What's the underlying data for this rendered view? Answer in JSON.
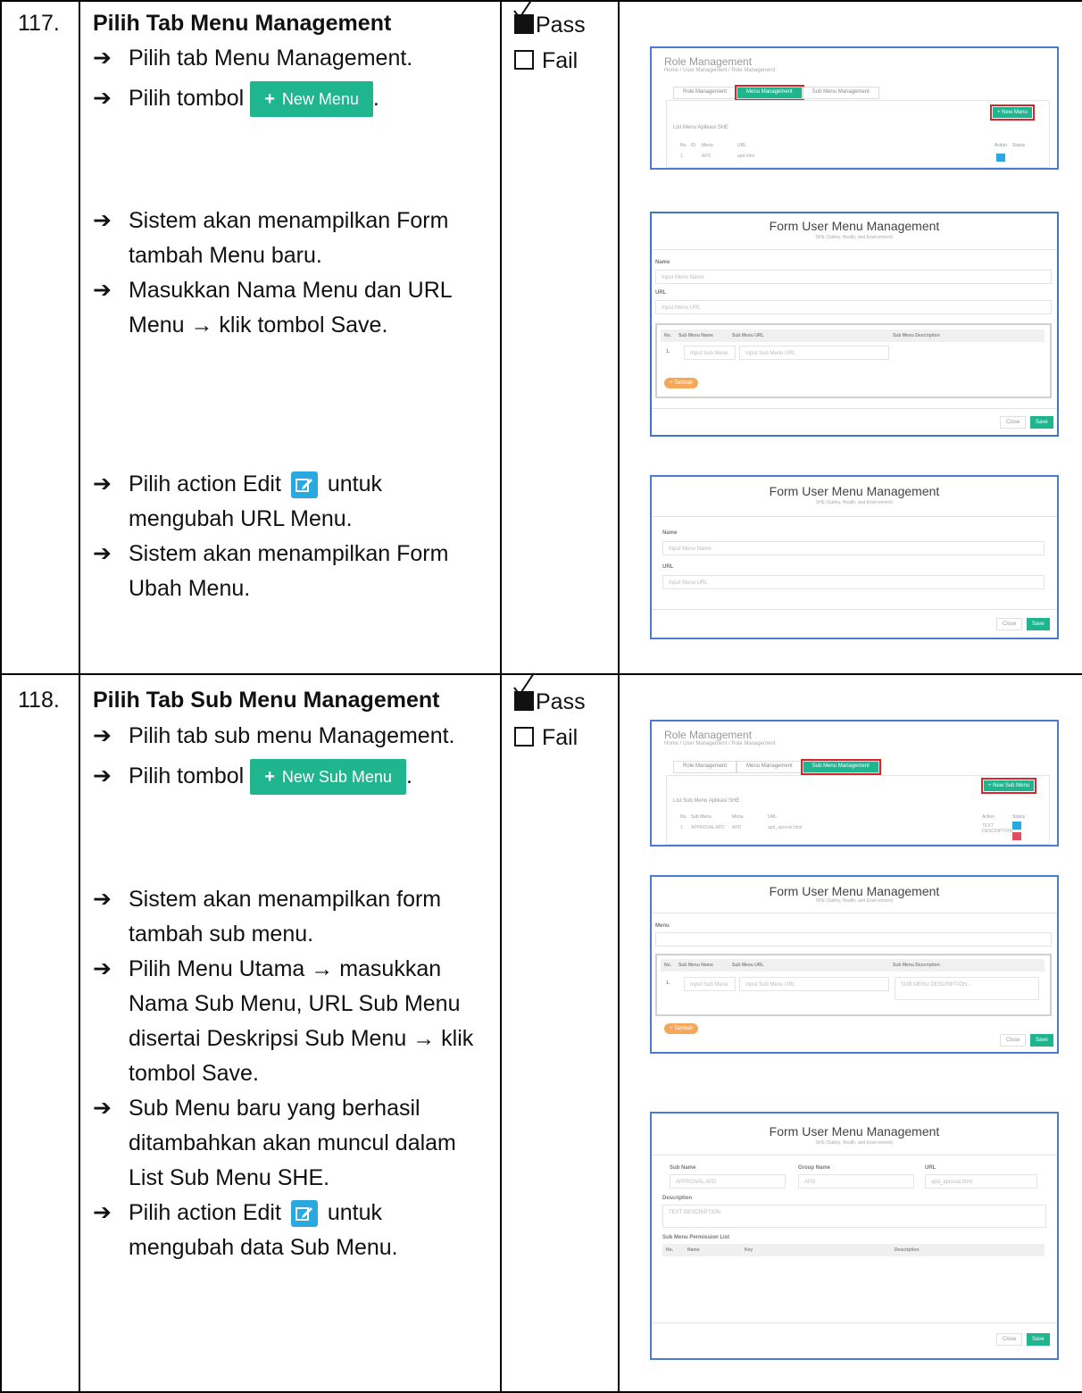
{
  "rows": [
    {
      "number": "117.",
      "title": "Pilih Tab Menu Management",
      "steps": [
        "Pilih tab Menu Management.",
        "Pilih tombol",
        "Sistem akan menampilkan Form tambah Menu baru.",
        "Masukkan Nama Menu dan URL Menu → klik tombol Save.",
        "Pilih action Edit",
        "mengubah URL Menu.",
        "Sistem akan menampilkan Form Ubah Menu."
      ],
      "inline_button": "New Menu",
      "edit_suffix": "untuk",
      "pass": "Pass",
      "fail": "Fail"
    },
    {
      "number": "118.",
      "title": "Pilih Tab Sub Menu Management",
      "steps": [
        "Pilih tab sub menu Management.",
        "Pilih tombol",
        "Sistem akan menampilkan form tambah sub menu.",
        "Pilih Menu Utama → masukkan Nama Sub Menu, URL Sub Menu disertai Deskripsi Sub Menu → klik tombol Save.",
        "Sub Menu baru yang berhasil ditambahkan akan muncul dalam List Sub Menu SHE.",
        "Pilih action Edit",
        "mengubah data Sub Menu."
      ],
      "inline_button": "New Sub Menu",
      "edit_suffix": "untuk",
      "pass": "Pass",
      "fail": "Fail"
    }
  ],
  "shots": {
    "role_mgmt_1": {
      "title": "Role Management",
      "crumb": "Home / User Management / Role Management",
      "tabs": [
        "Role Management",
        "Menu Management",
        "Sub Menu Management"
      ],
      "new_btn": "+ New Menu",
      "list_label": "List Menu Aplikasi SHE",
      "headers": [
        "No.",
        "ID",
        "Menu",
        "URL",
        "Action",
        "Status"
      ],
      "row": [
        "1.",
        "",
        "APD",
        "apd.html"
      ]
    },
    "form_menu_add": {
      "title": "Form User Menu Management",
      "subtitle": "SHE (Safety, Health, and Environment)",
      "name_label": "Name",
      "name_placeholder": "Input Menu Name",
      "url_label": "URL",
      "url_placeholder": "Input Menu URL",
      "table_headers": [
        "No.",
        "Sub Menu Name",
        "Sub Menu URL",
        "Sub Menu Description"
      ],
      "row_no": "1.",
      "sub_name_placeholder": "Input Sub Menu",
      "sub_url_placeholder": "Input Sub Menu URL",
      "tambah": "+ Tambah",
      "close": "Close",
      "save": "Save"
    },
    "form_menu_edit": {
      "title": "Form User Menu Management",
      "subtitle": "SHE (Safety, Health, and Environment)",
      "name_label": "Name",
      "name_placeholder": "Input Menu Name",
      "url_label": "URL",
      "url_placeholder": "Input Menu URL",
      "close": "Close",
      "save": "Save"
    },
    "role_mgmt_2": {
      "title": "Role Management",
      "crumb": "Home / User Management / Role Management",
      "tabs": [
        "Role Management",
        "Menu Management",
        "Sub Menu Management"
      ],
      "new_btn": "+ New Sub Menu",
      "list_label": "List Sub Menu Aplikasi SHE",
      "headers": [
        "No.",
        "Sub Menu",
        "Menu",
        "URL",
        "Action",
        "Status"
      ],
      "row": [
        "1.",
        "APPROVAL APD",
        "APD",
        "apd_aproval.html",
        "TEXT DESCRIPTION"
      ]
    },
    "form_sub_add": {
      "title": "Form User Menu Management",
      "subtitle": "SHE (Safety, Health, and Environment)",
      "menu_label": "Menu",
      "table_headers": [
        "No.",
        "Sub Menu Name",
        "Sub Menu URL",
        "Sub Menu Description"
      ],
      "row_no": "1.",
      "sub_name_placeholder": "Input Sub Menu",
      "sub_url_placeholder": "Input Sub Menu URL",
      "desc_placeholder": "SUB MENU DESCRIPTION...",
      "tambah": "+ Tambah",
      "close": "Close",
      "save": "Save"
    },
    "form_sub_edit": {
      "title": "Form User Menu Management",
      "subtitle": "SHE (Safety, Health, and Environment)",
      "sub_name_label": "Sub Name",
      "sub_name_value": "APPROVAL APD",
      "group_label": "Group Name",
      "group_value": "APD",
      "url_label": "URL",
      "url_value": "apd_aproval.html",
      "desc_label": "Description",
      "desc_value": "TEXT DESCRIPTION",
      "perm_label": "Sub Menu Permission List",
      "perm_headers": [
        "No.",
        "Name",
        "Key",
        "Description"
      ],
      "close": "Close",
      "save": "Save"
    }
  }
}
